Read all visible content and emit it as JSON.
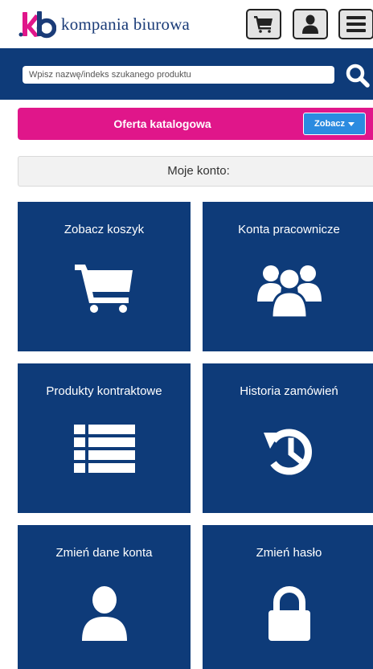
{
  "header": {
    "logo_text": "kompania biurowa",
    "brand_colors": {
      "pink": "#e0168a",
      "navy": "#0e3b79"
    },
    "icons": [
      "cart-icon",
      "user-icon",
      "hamburger-menu-icon"
    ]
  },
  "search": {
    "placeholder": "Wpisz nazwę/indeks szukanego produktu",
    "value": "",
    "icon": "search-icon"
  },
  "catalog": {
    "title": "Oferta katalogowa",
    "button_label": "Zobacz"
  },
  "account": {
    "title": "Moje konto:"
  },
  "tiles": [
    {
      "label": "Zobacz koszyk",
      "icon": "cart-icon"
    },
    {
      "label": "Konta pracownicze",
      "icon": "users-icon"
    },
    {
      "label": "Produkty kontraktowe",
      "icon": "list-icon"
    },
    {
      "label": "Historia zamówień",
      "icon": "history-icon"
    },
    {
      "label": "Zmień dane konta",
      "icon": "user-icon"
    },
    {
      "label": "Zmień hasło",
      "icon": "lock-icon"
    }
  ]
}
